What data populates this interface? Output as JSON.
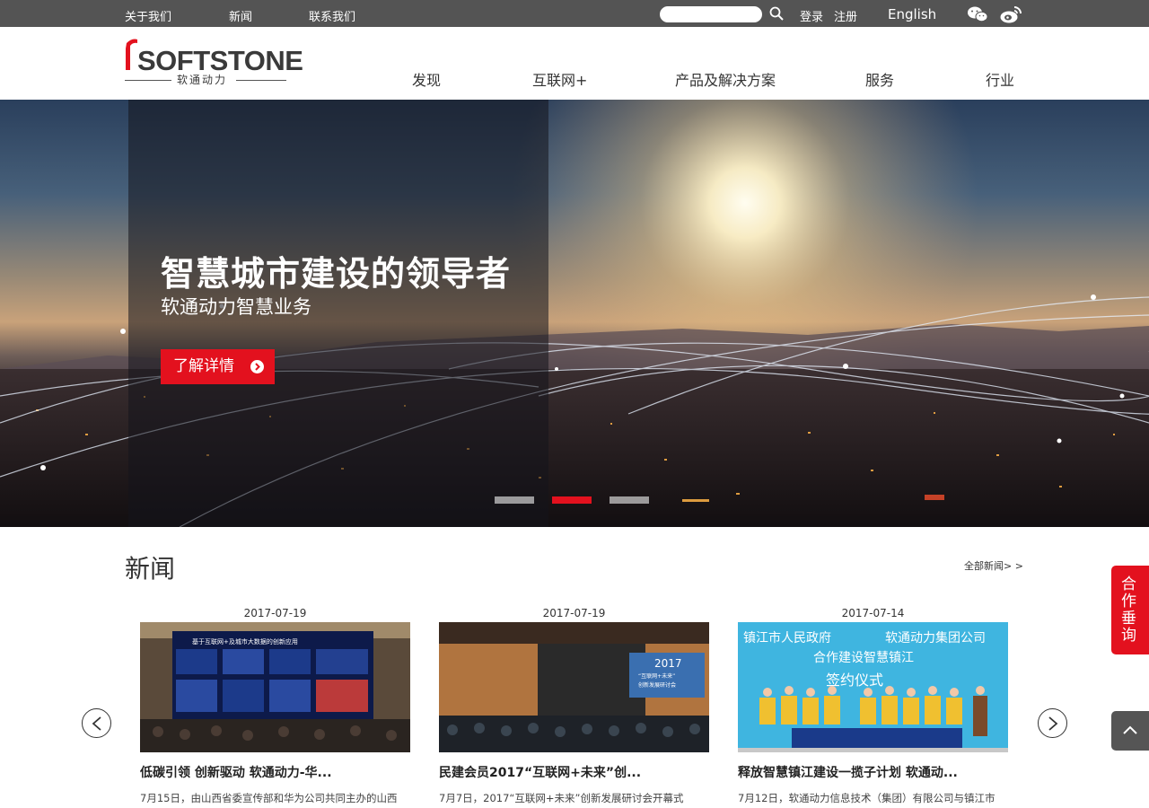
{
  "topbar": {
    "links": [
      "关于我们",
      "新闻",
      "联系我们"
    ],
    "search_placeholder": "",
    "login": "登录",
    "register": "注册",
    "language": "English"
  },
  "header": {
    "logo_main": "SOFTSTONE",
    "logo_sub": "软通动力",
    "nav": [
      "发现",
      "互联网+",
      "产品及解决方案",
      "服务",
      "行业"
    ]
  },
  "hero": {
    "title": "智慧城市建设的领导者",
    "subtitle": "软通动力智慧业务",
    "button": "了解详情",
    "active_slide": 2,
    "slide_count": 3
  },
  "news": {
    "section_title": "新闻",
    "all_link": "全部新闻> >",
    "items": [
      {
        "date": "2017-07-19",
        "headline": "低碳引领 创新驱动 软通动力-华...",
        "summary": "7月15日，由山西省委宣传部和华为公司共同主办的山西"
      },
      {
        "date": "2017-07-19",
        "headline": "民建会员2017“互联网+未来”创...",
        "summary": "7月7日，2017“互联网+未来”创新发展研讨会开幕式"
      },
      {
        "date": "2017-07-14",
        "headline": "释放智慧镇江建设一揽子计划 软通动...",
        "summary": "7月12日，软通动力信息技术（集团）有限公司与镇江市",
        "image_text": [
          "镇江市人民政府",
          "软通动力集团公司",
          "合作建设智慧镇江",
          "签约仪式"
        ]
      }
    ],
    "slide1_screen_text": "基于互联网+及城市大数据的创新应用",
    "slide2_screen_text": [
      "2017",
      "“互联网+未来”",
      "创新发展研讨会"
    ]
  },
  "side": {
    "consult": "合作垂询"
  },
  "colors": {
    "accent_red": "#e3111e",
    "topbar_gray": "#545454"
  }
}
